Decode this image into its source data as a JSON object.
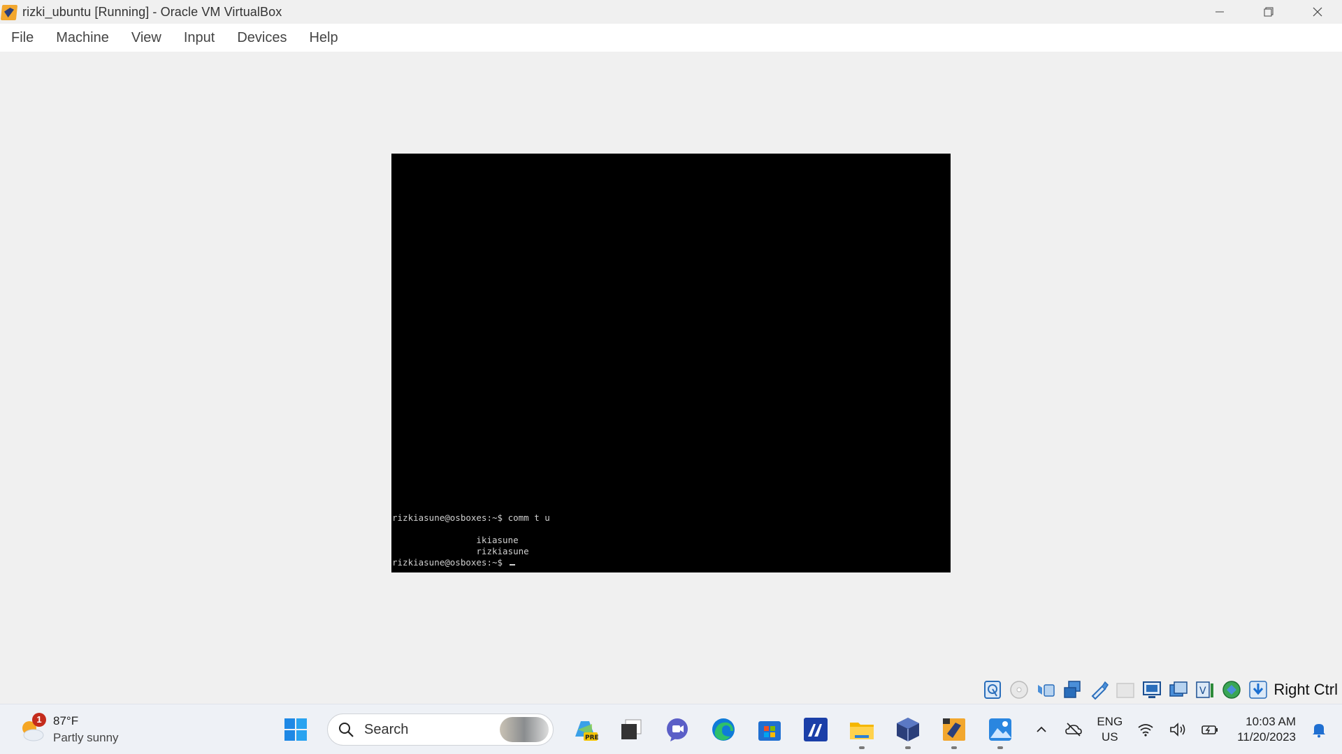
{
  "window": {
    "title": "rizki_ubuntu [Running] - Oracle VM VirtualBox",
    "controls": [
      "minimize",
      "restore",
      "close"
    ]
  },
  "menu": [
    "File",
    "Machine",
    "View",
    "Input",
    "Devices",
    "Help"
  ],
  "terminal": {
    "lines": [
      "rizkiasune@osboxes:~$ comm t u",
      "",
      "                ikiasune",
      "                rizkiasune",
      "rizkiasune@osboxes:~$ "
    ]
  },
  "statusbar": {
    "icons": [
      "hard-disk-icon",
      "optical-drive-icon",
      "audio-icon",
      "network-icon",
      "usb-icon",
      "shared-folders-icon",
      "display-icon",
      "recording-icon",
      "virtualization-icon",
      "mouse-integration-icon",
      "keyboard-capture-icon"
    ],
    "host_key": "Right Ctrl"
  },
  "taskbar": {
    "weather": {
      "badge": "1",
      "temp": "87°F",
      "desc": "Partly sunny"
    },
    "search": {
      "label": "Search"
    },
    "apps": [
      "copilot-pre-icon",
      "task-view-icon",
      "teams-chat-icon",
      "edge-icon",
      "store-icon",
      "ide-icon",
      "file-explorer-icon",
      "virtualbox-icon",
      "virtualbox-vm-icon",
      "photos-icon"
    ],
    "language": {
      "line1": "ENG",
      "line2": "US"
    },
    "clock": {
      "time": "10:03 AM",
      "date": "11/20/2023"
    }
  }
}
